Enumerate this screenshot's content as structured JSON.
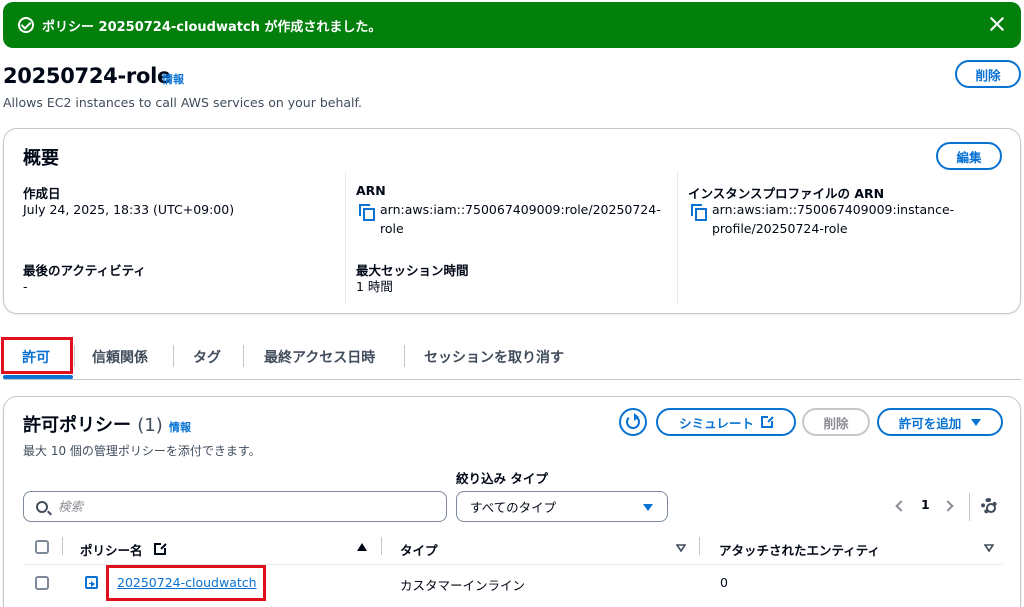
{
  "flash": {
    "message": "ポリシー 20250724-cloudwatch が作成されました。",
    "icon": "check-circle-icon",
    "color": "#037f0c"
  },
  "header": {
    "title": "20250724-role",
    "info": "情報",
    "description": "Allows EC2 instances to call AWS services on your behalf.",
    "delete_label": "削除"
  },
  "summary": {
    "title": "概要",
    "edit_label": "編集",
    "created_label": "作成日",
    "created_value": "July 24, 2025, 18:33 (UTC+09:00)",
    "last_activity_label": "最後のアクティビティ",
    "last_activity_value": "-",
    "arn_label": "ARN",
    "arn_line1": "arn:aws:iam::750067409009:role/20250724-",
    "arn_line2": "role",
    "max_session_label": "最大セッション時間",
    "max_session_value": "1 時間",
    "instance_profile_label": "インスタンスプロファイルの ARN",
    "instance_profile_line1": "arn:aws:iam::750067409009:instance-",
    "instance_profile_line2": "profile/20250724-role"
  },
  "tabs": [
    {
      "label": "許可",
      "active": true
    },
    {
      "label": "信頼関係"
    },
    {
      "label": "タグ"
    },
    {
      "label": "最終アクセス日時"
    },
    {
      "label": "セッションを取り消す"
    }
  ],
  "policies": {
    "title": "許可ポリシー",
    "count": "(1)",
    "info": "情報",
    "subtitle": "最大 10 個の管理ポリシーを添付できます。",
    "simulate_label": "シミュレート",
    "delete_label": "削除",
    "add_label": "許可を追加",
    "filter_label": "絞り込み タイプ",
    "search_placeholder": "検索",
    "type_select": "すべてのタイプ",
    "page": "1",
    "columns": {
      "name": "ポリシー名",
      "type": "タイプ",
      "entities": "アタッチされたエンティティ"
    },
    "rows": [
      {
        "name": "20250724-cloudwatch",
        "type": "カスタマーインライン",
        "entities": "0"
      }
    ]
  },
  "colors": {
    "accent": "#0972d3",
    "highlight": "#e0101e"
  }
}
